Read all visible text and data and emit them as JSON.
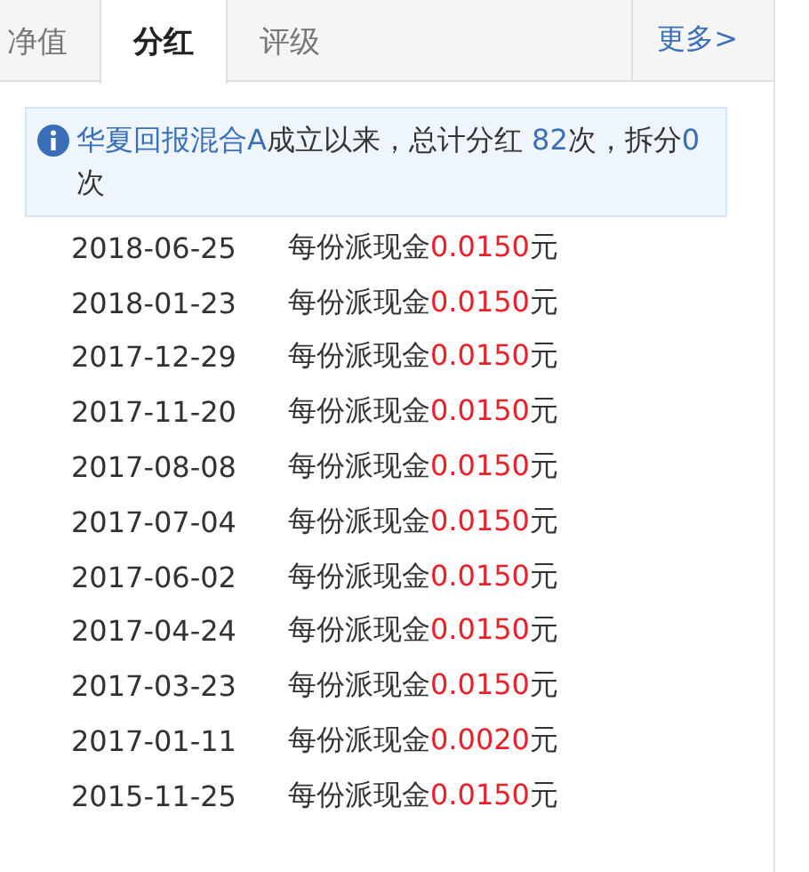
{
  "tabs": [
    {
      "label": "净值",
      "selected": false
    },
    {
      "label": "分红",
      "selected": true
    },
    {
      "label": "评级",
      "selected": false
    }
  ],
  "more_link": "更多>",
  "notice": {
    "fund_name": "华夏回报混合A",
    "text_1": "成立以来，总计分红 ",
    "dividend_count": "82",
    "text_2": "次，拆分",
    "split_count": "0",
    "text_3": "次"
  },
  "rows": [
    {
      "date": "2018-06-25",
      "prefix": "每份派现金",
      "amount": "0.0150",
      "unit": "元"
    },
    {
      "date": "2018-01-23",
      "prefix": "每份派现金",
      "amount": "0.0150",
      "unit": "元"
    },
    {
      "date": "2017-12-29",
      "prefix": "每份派现金",
      "amount": "0.0150",
      "unit": "元"
    },
    {
      "date": "2017-11-20",
      "prefix": "每份派现金",
      "amount": "0.0150",
      "unit": "元"
    },
    {
      "date": "2017-08-08",
      "prefix": "每份派现金",
      "amount": "0.0150",
      "unit": "元"
    },
    {
      "date": "2017-07-04",
      "prefix": "每份派现金",
      "amount": "0.0150",
      "unit": "元"
    },
    {
      "date": "2017-06-02",
      "prefix": "每份派现金",
      "amount": "0.0150",
      "unit": "元"
    },
    {
      "date": "2017-04-24",
      "prefix": "每份派现金",
      "amount": "0.0150",
      "unit": "元"
    },
    {
      "date": "2017-03-23",
      "prefix": "每份派现金",
      "amount": "0.0150",
      "unit": "元"
    },
    {
      "date": "2017-01-11",
      "prefix": "每份派现金",
      "amount": "0.0020",
      "unit": "元"
    },
    {
      "date": "2015-11-25",
      "prefix": "每份派现金",
      "amount": "0.0150",
      "unit": "元"
    }
  ]
}
